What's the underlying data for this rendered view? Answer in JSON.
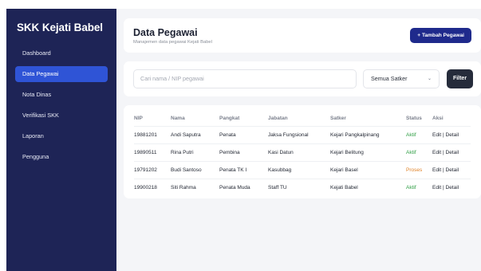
{
  "sidebar": {
    "brand": "SKK Kejati Babel",
    "items": [
      {
        "label": "Dashboard",
        "active": false
      },
      {
        "label": "Data Pegawai",
        "active": true
      },
      {
        "label": "Nota Dinas",
        "active": false
      },
      {
        "label": "Verifikasi SKK",
        "active": false
      },
      {
        "label": "Laporan",
        "active": false
      },
      {
        "label": "Pengguna",
        "active": false
      }
    ]
  },
  "header": {
    "title": "Data Pegawai",
    "subtitle": "Manajemen data pegawai Kejati Babel",
    "add_label": "+ Tambah Pegawai"
  },
  "filters": {
    "search_placeholder": "Cari nama / NIP pegawai",
    "satker_value": "Semua Satker",
    "filter_label": "Filter"
  },
  "table": {
    "columns": [
      "NIP",
      "Nama",
      "Pangkat",
      "Jabatan",
      "Satker",
      "Status",
      "Aksi"
    ],
    "rows": [
      {
        "nip": "19881201",
        "nama": "Andi Saputra",
        "pangkat": "Penata",
        "jabatan": "Jaksa Fungsional",
        "satker": "Kejari Pangkalpinang",
        "status": "Aktif",
        "aksi": "Edit | Detail"
      },
      {
        "nip": "19890511",
        "nama": "Rina Putri",
        "pangkat": "Pembina",
        "jabatan": "Kasi Datun",
        "satker": "Kejari Belitung",
        "status": "Aktif",
        "aksi": "Edit | Detail"
      },
      {
        "nip": "19791202",
        "nama": "Budi Santoso",
        "pangkat": "Penata TK I",
        "jabatan": "Kasubbag",
        "satker": "Kejari Basel",
        "status": "Proses",
        "aksi": "Edit | Detail"
      },
      {
        "nip": "19900218",
        "nama": "Siti Rahma",
        "pangkat": "Penata Muda",
        "jabatan": "Staff TU",
        "satker": "Kejati Babel",
        "status": "Aktif",
        "aksi": "Edit | Detail"
      }
    ]
  },
  "colors": {
    "sidebar_bg": "#1e2456",
    "active_item": "#2f54d6",
    "primary_button": "#1f2a8c",
    "status_aktif": "#2f9e44",
    "status_proses": "#e0832a"
  }
}
